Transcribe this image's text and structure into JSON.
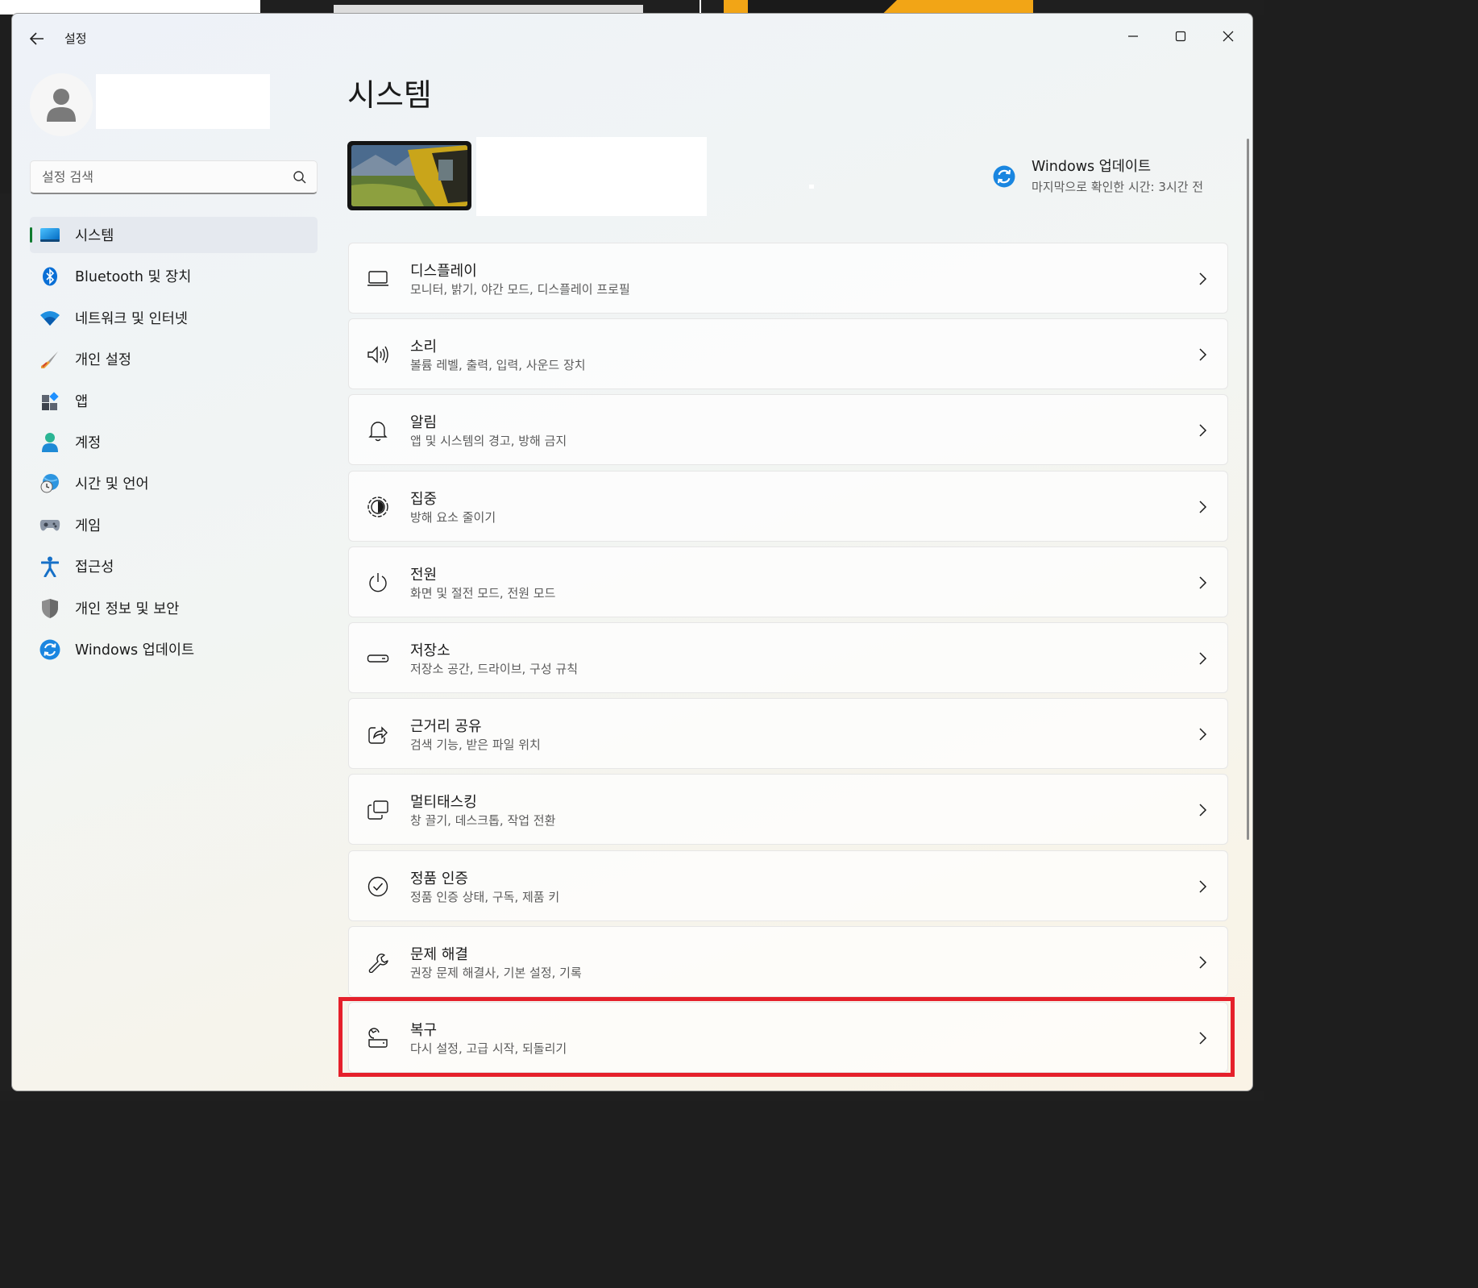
{
  "window": {
    "title": "설정"
  },
  "profile": {
    "avatar_icon": "person-icon"
  },
  "search": {
    "placeholder": "설정 검색"
  },
  "nav": [
    {
      "label": "시스템",
      "icon": "system-icon",
      "active": true
    },
    {
      "label": "Bluetooth 및 장치",
      "icon": "bluetooth-icon"
    },
    {
      "label": "네트워크 및 인터넷",
      "icon": "wifi-icon"
    },
    {
      "label": "개인 설정",
      "icon": "brush-icon"
    },
    {
      "label": "앱",
      "icon": "apps-icon"
    },
    {
      "label": "계정",
      "icon": "account-icon"
    },
    {
      "label": "시간 및 언어",
      "icon": "clock-globe-icon"
    },
    {
      "label": "게임",
      "icon": "gamepad-icon"
    },
    {
      "label": "접근성",
      "icon": "accessibility-icon"
    },
    {
      "label": "개인 정보 및 보안",
      "icon": "shield-icon"
    },
    {
      "label": "Windows 업데이트",
      "icon": "update-icon"
    }
  ],
  "main": {
    "title": "시스템",
    "update": {
      "title": "Windows 업데이트",
      "subtitle": "마지막으로 확인한 시간: 3시간 전"
    },
    "cards": [
      {
        "title": "디스플레이",
        "subtitle": "모니터, 밝기, 야간 모드, 디스플레이 프로필",
        "icon": "monitor-icon"
      },
      {
        "title": "소리",
        "subtitle": "볼륨 레벨, 출력, 입력, 사운드 장치",
        "icon": "speaker-icon"
      },
      {
        "title": "알림",
        "subtitle": "앱 및 시스템의 경고, 방해 금지",
        "icon": "bell-icon"
      },
      {
        "title": "집중",
        "subtitle": "방해 요소 줄이기",
        "icon": "focus-icon"
      },
      {
        "title": "전원",
        "subtitle": "화면 및 절전 모드, 전원 모드",
        "icon": "power-icon"
      },
      {
        "title": "저장소",
        "subtitle": "저장소 공간, 드라이브, 구성 규칙",
        "icon": "storage-icon"
      },
      {
        "title": "근거리 공유",
        "subtitle": "검색 기능, 받은 파일 위치",
        "icon": "share-icon"
      },
      {
        "title": "멀티태스킹",
        "subtitle": "창 끌기, 데스크톱, 작업 전환",
        "icon": "multitask-icon"
      },
      {
        "title": "정품 인증",
        "subtitle": "정품 인증 상태, 구독, 제품 키",
        "icon": "check-circle-icon"
      },
      {
        "title": "문제 해결",
        "subtitle": "권장 문제 해결사, 기본 설정, 기록",
        "icon": "wrench-icon"
      },
      {
        "title": "복구",
        "subtitle": "다시 설정, 고급 시작, 되돌리기",
        "icon": "recovery-icon",
        "highlighted": true
      }
    ]
  },
  "colors": {
    "accent": "#0067c0",
    "active_indicator": "#0f7a2e",
    "highlight": "#e5202b"
  }
}
